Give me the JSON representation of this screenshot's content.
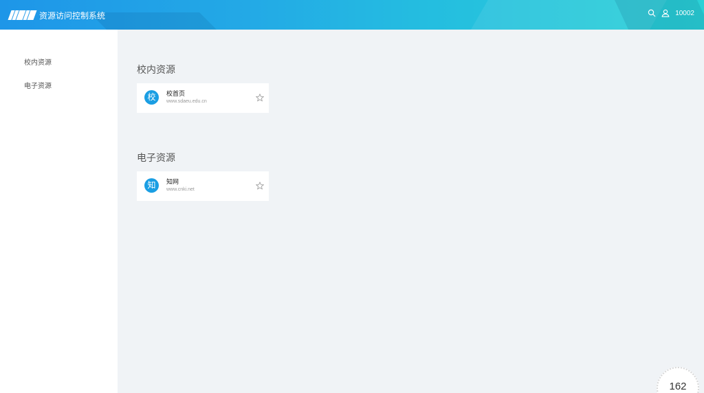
{
  "header": {
    "app_title": "资源访问控制系统",
    "username": "10002",
    "icons": [
      "search-icon",
      "user-icon"
    ]
  },
  "sidebar": {
    "items": [
      {
        "label": "校内资源"
      },
      {
        "label": "电子资源"
      }
    ]
  },
  "sections": [
    {
      "title": "校内资源",
      "cards": [
        {
          "avatar_char": "校",
          "name": "校首页",
          "url": "www.sdaeu.edu.cn"
        }
      ]
    },
    {
      "title": "电子资源",
      "cards": [
        {
          "avatar_char": "知",
          "name": "知网",
          "url": "www.cnki.net"
        }
      ]
    }
  ],
  "badge": {
    "count": "162"
  },
  "colors": {
    "header_gradient_start": "#1e96e8",
    "header_gradient_end": "#2bd1d6",
    "avatar_bg": "#1a9ee3",
    "content_bg": "#f0f3f6"
  }
}
